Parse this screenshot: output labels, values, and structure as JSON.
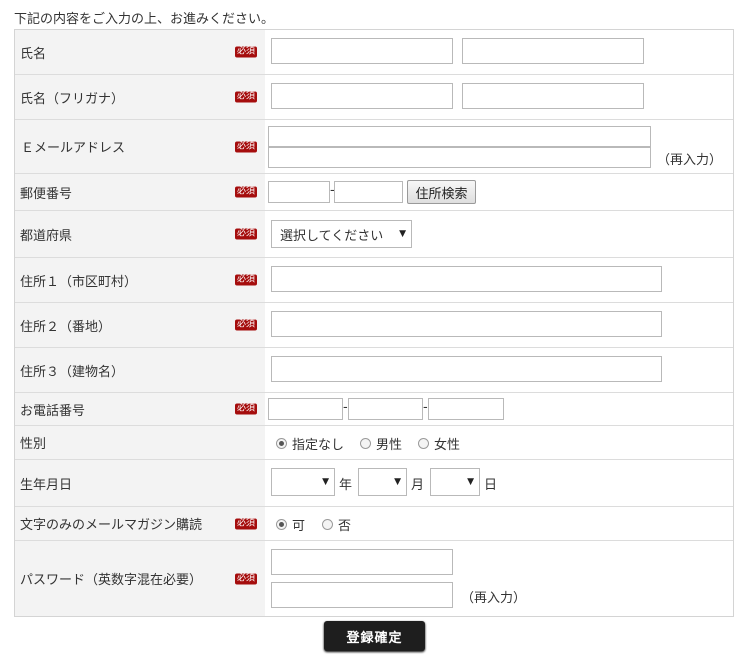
{
  "intro": "下記の内容をご入力の上、お進みください。",
  "required_badge": "必須",
  "rows": {
    "name": {
      "label": "氏名"
    },
    "name_kana": {
      "label": "氏名（フリガナ）"
    },
    "email": {
      "label": "Ｅメールアドレス",
      "reenter": "（再入力）"
    },
    "postal": {
      "label": "郵便番号",
      "dash": "-",
      "search_button": "住所検索"
    },
    "prefecture": {
      "label": "都道府県",
      "selected": "選択してください"
    },
    "address1": {
      "label": "住所１（市区町村）"
    },
    "address2": {
      "label": "住所２（番地）"
    },
    "address3": {
      "label": "住所３（建物名）"
    },
    "phone": {
      "label": "お電話番号",
      "dash": "-"
    },
    "gender": {
      "label": "性別",
      "options": [
        "指定なし",
        "男性",
        "女性"
      ],
      "selected": "指定なし"
    },
    "birthday": {
      "label": "生年月日",
      "year": "年",
      "month": "月",
      "day": "日"
    },
    "newsletter": {
      "label": "文字のみのメールマガジン購読",
      "options": [
        "可",
        "否"
      ],
      "selected": "可"
    },
    "password": {
      "label": "パスワード（英数字混在必要）",
      "reenter": "（再入力）"
    }
  },
  "submit_label": "登録確定",
  "colors": {
    "badge": "#a50d0d",
    "label_bg": "#f3f3f3",
    "submit_bg": "#1e1e1e"
  }
}
